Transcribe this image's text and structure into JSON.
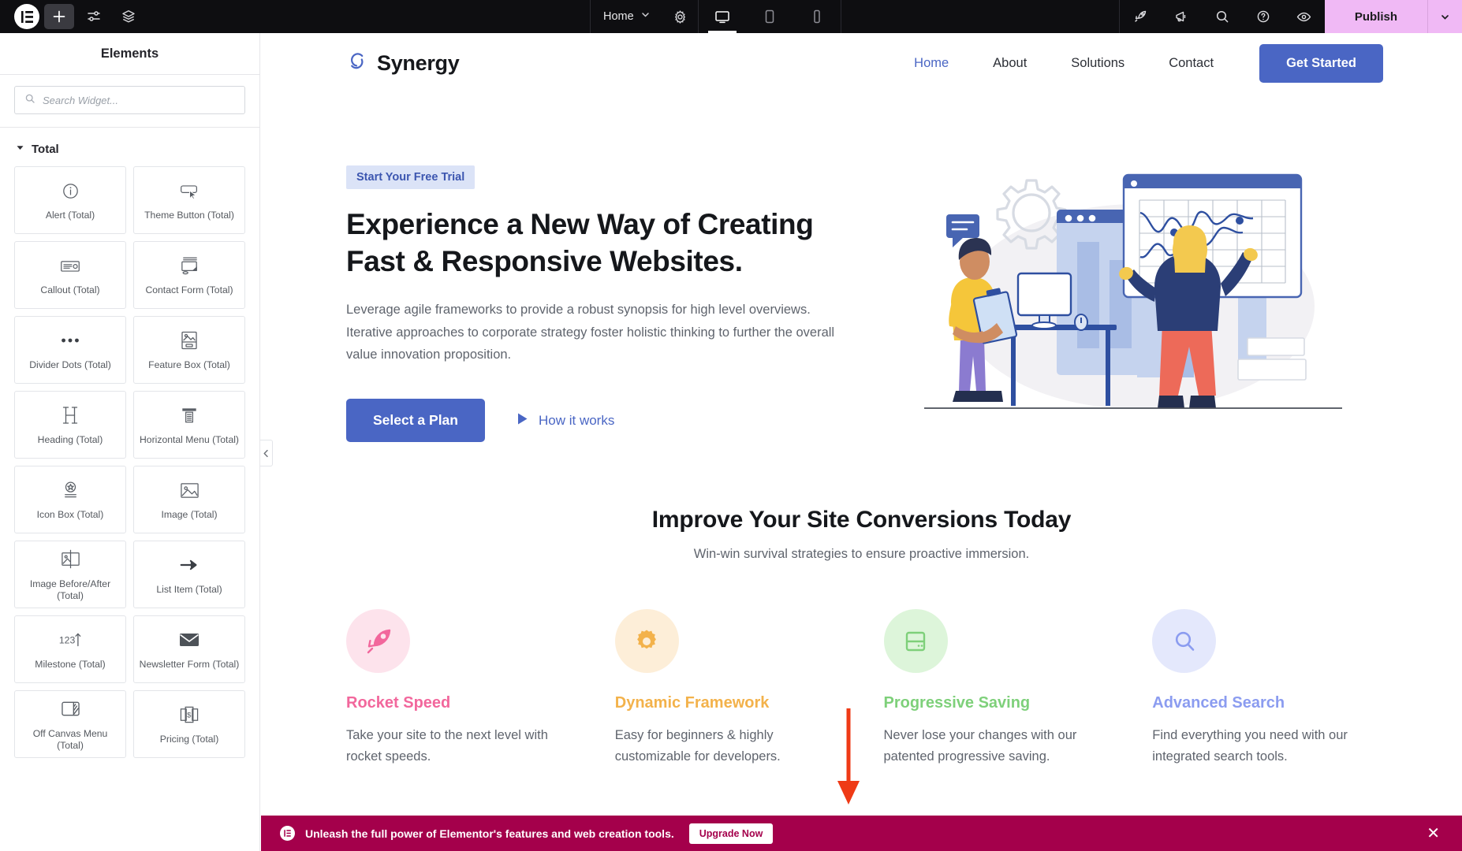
{
  "topbar": {
    "logo_icon": "elementor-logo-icon",
    "add_icon": "plus-icon",
    "settings_icon": "sliders-icon",
    "layers_icon": "layers-icon",
    "document_title": "Home",
    "document_caret_icon": "chevron-down-icon",
    "page_settings_icon": "gear-icon",
    "devices": [
      {
        "name": "desktop",
        "icon": "desktop-icon",
        "active": true
      },
      {
        "name": "tablet",
        "icon": "tablet-icon",
        "active": false
      },
      {
        "name": "mobile",
        "icon": "mobile-icon",
        "active": false
      }
    ],
    "right_icons": [
      {
        "name": "rocket",
        "icon": "rocket-icon"
      },
      {
        "name": "whats-new",
        "icon": "megaphone-icon"
      },
      {
        "name": "finder",
        "icon": "search-icon"
      },
      {
        "name": "help",
        "icon": "question-circle-icon"
      },
      {
        "name": "preview",
        "icon": "eye-icon"
      }
    ],
    "publish_label": "Publish",
    "publish_caret_icon": "chevron-down-icon",
    "publish_color": "#f0b9f5"
  },
  "panel": {
    "title": "Elements",
    "search": {
      "placeholder": "Search Widget...",
      "value": "",
      "icon": "search-icon"
    },
    "collapse_icon": "chevron-left-icon",
    "category": {
      "label": "Total",
      "toggle_icon": "caret-down-icon"
    },
    "widgets": [
      {
        "label": "Alert (Total)",
        "icon": "info-circle-icon"
      },
      {
        "label": "Theme Button (Total)",
        "icon": "button-cursor-icon"
      },
      {
        "label": "Callout (Total)",
        "icon": "callout-icon"
      },
      {
        "label": "Contact Form (Total)",
        "icon": "contact-form-icon"
      },
      {
        "label": "Divider Dots (Total)",
        "icon": "dots-icon"
      },
      {
        "label": "Feature Box (Total)",
        "icon": "feature-box-icon"
      },
      {
        "label": "Heading (Total)",
        "icon": "heading-h-icon"
      },
      {
        "label": "Horizontal Menu (Total)",
        "icon": "horizontal-menu-icon"
      },
      {
        "label": "Icon Box (Total)",
        "icon": "icon-box-star-icon"
      },
      {
        "label": "Image (Total)",
        "icon": "image-icon"
      },
      {
        "label": "Image Before/After (Total)",
        "icon": "image-before-after-icon"
      },
      {
        "label": "List Item (Total)",
        "icon": "arrow-right-icon"
      },
      {
        "label": "Milestone (Total)",
        "icon": "milestone-123-icon"
      },
      {
        "label": "Newsletter Form (Total)",
        "icon": "envelope-icon"
      },
      {
        "label": "Off Canvas Menu (Total)",
        "icon": "off-canvas-icon"
      },
      {
        "label": "Pricing (Total)",
        "icon": "pricing-dollar-icon"
      }
    ]
  },
  "site": {
    "brand": {
      "name": "Synergy",
      "logo_icon": "synergy-swirl-icon"
    },
    "nav": [
      {
        "label": "Home",
        "active": true
      },
      {
        "label": "About",
        "active": false
      },
      {
        "label": "Solutions",
        "active": false
      },
      {
        "label": "Contact",
        "active": false
      }
    ],
    "header_cta": "Get Started",
    "hero": {
      "eyebrow": "Start Your Free Trial",
      "heading": "Experience a New Way of Creating Fast & Responsive Websites.",
      "paragraph": "Leverage agile frameworks to provide a robust synopsis for high level overviews. Iterative approaches to corporate strategy foster holistic thinking to further the overall value innovation proposition.",
      "primary_cta": "Select a Plan",
      "secondary_cta": "How it works",
      "secondary_icon": "play-triangle-icon",
      "illustration": "team-analytics-illustration"
    },
    "section2": {
      "title": "Improve Your Site Conversions Today",
      "subtitle": "Win-win survival strategies to ensure proactive immersion."
    },
    "features": [
      {
        "icon": "rocket-icon",
        "title": "Rocket Speed",
        "desc": "Take your site to the next level with rocket speeds.",
        "color": "#f2679c",
        "bg": "#fde3ec"
      },
      {
        "icon": "gear-icon",
        "title": "Dynamic Framework",
        "desc": "Easy for beginners & highly customizable for developers.",
        "color": "#f3b24b",
        "bg": "#fdeed8"
      },
      {
        "icon": "save-drive-icon",
        "title": "Progressive Saving",
        "desc": "Never lose your changes with our patented progressive saving.",
        "color": "#7ed07a",
        "bg": "#ddf5da"
      },
      {
        "icon": "search-icon",
        "title": "Advanced Search",
        "desc": "Find everything you need with our integrated search tools.",
        "color": "#8b9cf0",
        "bg": "#e4e8fc"
      }
    ],
    "annotation": {
      "type": "red-down-arrow",
      "color": "#ef3a16"
    }
  },
  "banner": {
    "icon": "elementor-badge-icon",
    "message": "Unleash the full power of Elementor's features and web creation tools.",
    "button": "Upgrade Now",
    "close_icon": "close-icon",
    "color": "#a4004b"
  }
}
